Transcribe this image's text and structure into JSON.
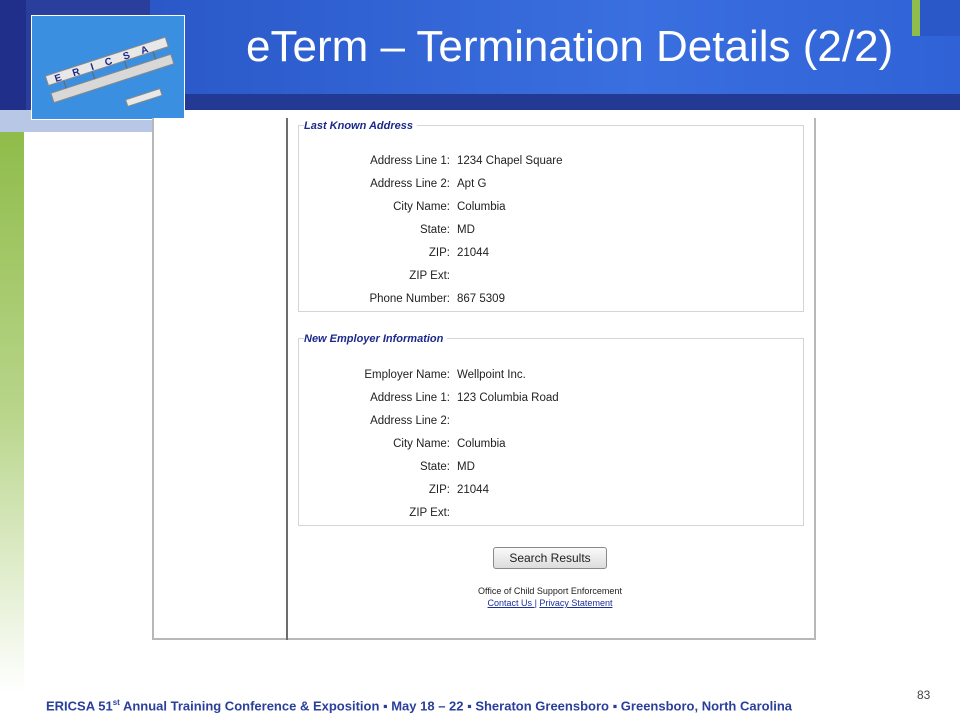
{
  "slide": {
    "title": "eTerm – Termination Details (2/2)",
    "page_number": "83",
    "footer_prefix": "ERICSA 51",
    "footer_sup": "st",
    "footer_rest": " Annual Training Conference & Exposition  ▪  May 18 – 22  ▪  Sheraton Greensboro  ▪  Greensboro, North Carolina",
    "logo_text": "ERICSA"
  },
  "last_known_address": {
    "legend": "Last Known Address",
    "rows": [
      {
        "label": "Address Line 1:",
        "value": "1234 Chapel Square"
      },
      {
        "label": "Address Line 2:",
        "value": "Apt G"
      },
      {
        "label": "City Name:",
        "value": "Columbia"
      },
      {
        "label": "State:",
        "value": "MD"
      },
      {
        "label": "ZIP:",
        "value": "21044"
      },
      {
        "label": "ZIP Ext:",
        "value": ""
      },
      {
        "label": "Phone Number:",
        "value": "867 5309"
      }
    ]
  },
  "new_employer": {
    "legend": "New Employer Information",
    "rows": [
      {
        "label": "Employer Name:",
        "value": "Wellpoint Inc."
      },
      {
        "label": "Address Line 1:",
        "value": "123 Columbia Road"
      },
      {
        "label": "Address Line 2:",
        "value": ""
      },
      {
        "label": "City Name:",
        "value": "Columbia"
      },
      {
        "label": "State:",
        "value": "MD"
      },
      {
        "label": "ZIP:",
        "value": "21044"
      },
      {
        "label": "ZIP Ext:",
        "value": ""
      }
    ]
  },
  "search_button": "Search Results",
  "office": "Office of Child Support Enforcement",
  "links": {
    "contact": "Contact Us ",
    "separator": "|",
    "privacy": "Privacy Statement"
  }
}
